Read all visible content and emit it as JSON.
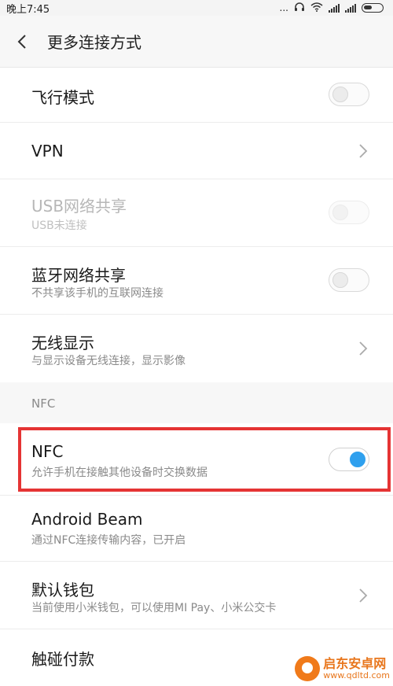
{
  "status_bar": {
    "time": "晚上7:45",
    "dots": "..."
  },
  "header": {
    "title": "更多连接方式"
  },
  "rows": [
    {
      "title": "飞行模式",
      "control": "toggle",
      "state": "off"
    },
    {
      "title": "VPN",
      "control": "chevron"
    },
    {
      "title": "USB网络共享",
      "subtitle": "USB未连接",
      "control": "toggle",
      "state": "disabled"
    },
    {
      "title": "蓝牙网络共享",
      "subtitle": "不共享该手机的互联网连接",
      "control": "toggle",
      "state": "off"
    },
    {
      "title": "无线显示",
      "subtitle": "与显示设备无线连接，显示影像",
      "control": "chevron"
    }
  ],
  "nfc_section": {
    "header": "NFC",
    "rows": [
      {
        "title": "NFC",
        "subtitle": "允许手机在接触其他设备时交换数据",
        "control": "toggle",
        "state": "on"
      },
      {
        "title": "Android Beam",
        "subtitle": "通过NFC连接传输内容，已开启"
      },
      {
        "title": "默认钱包",
        "subtitle": "当前使用小米钱包，可以使用MI Pay、小米公交卡",
        "control": "chevron"
      },
      {
        "title": "触碰付款"
      }
    ]
  },
  "colors": {
    "toggle_on": "#2fa0ee",
    "highlight": "#e53434",
    "watermark": "#e8761c"
  },
  "watermark": {
    "title": "启东安卓网",
    "url": "www.qdltd.com"
  }
}
